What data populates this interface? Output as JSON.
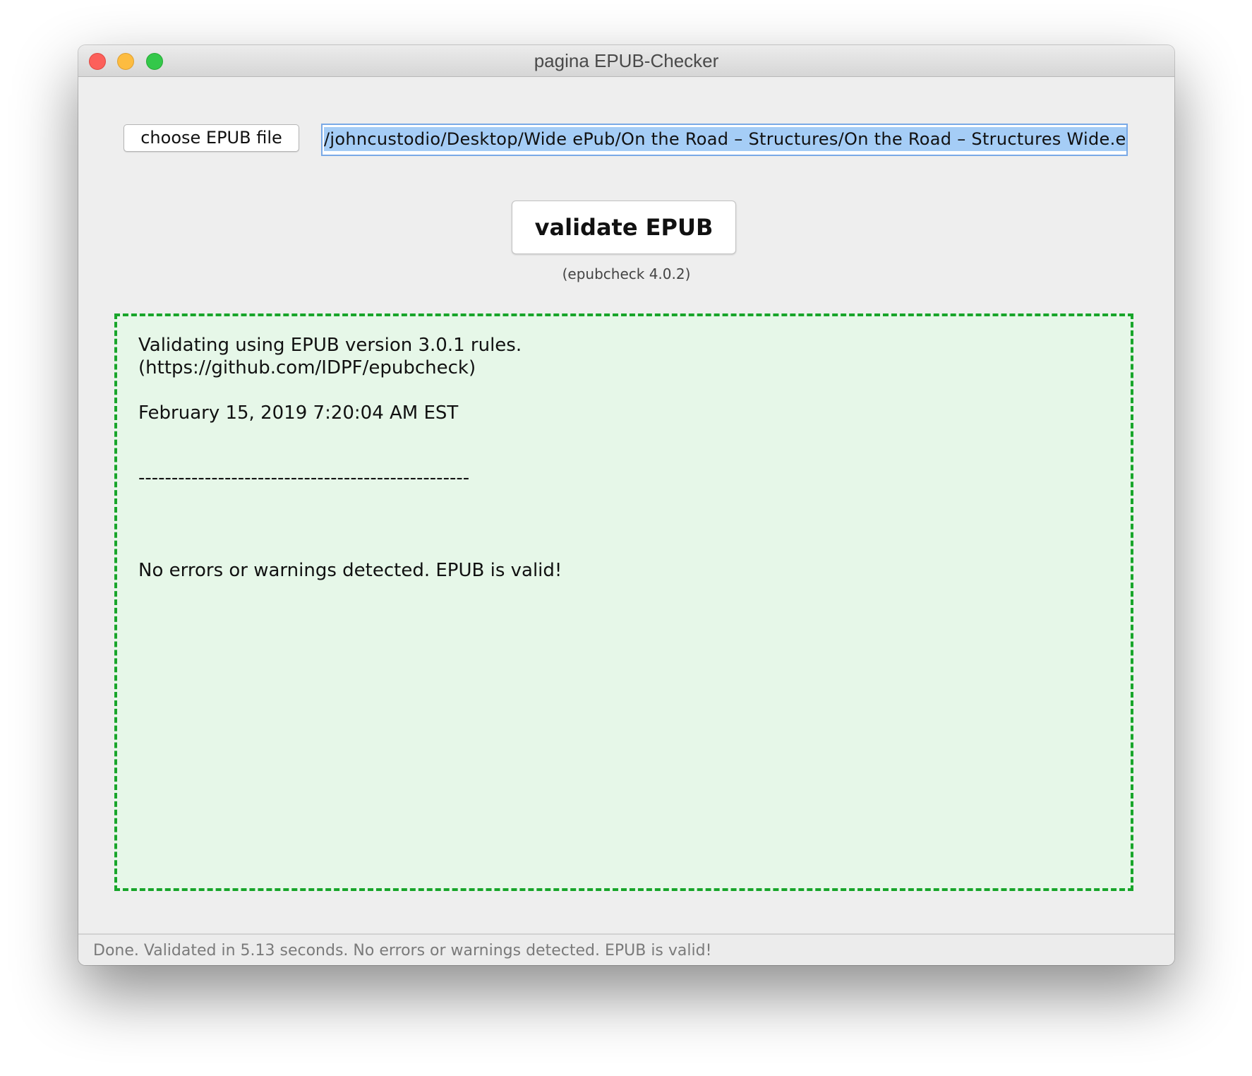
{
  "window": {
    "title": "pagina EPUB-Checker"
  },
  "toolbar": {
    "choose_label": "choose EPUB file",
    "file_path": "/johncustodio/Desktop/Wide ePub/On the Road – Structures/On the Road – Structures Wide.epub"
  },
  "validate": {
    "button_label": "validate EPUB",
    "version_label": "(epubcheck 4.0.2)"
  },
  "output": {
    "lines": [
      "Validating using EPUB version 3.0.1 rules.",
      "(https://github.com/IDPF/epubcheck)",
      "February 15, 2019 7:20:04 AM EST",
      "--------------------------------------------------",
      "No errors or warnings detected. EPUB is valid!"
    ],
    "border_color": "#18a52a",
    "background_color": "#e6f7e8"
  },
  "status": {
    "text": "Done. Validated in 5.13 seconds. No errors or warnings detected. EPUB is valid!"
  }
}
